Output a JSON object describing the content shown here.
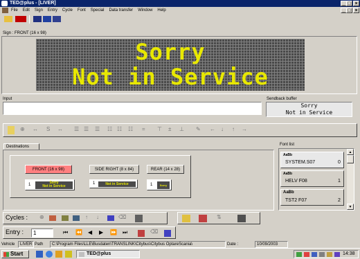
{
  "window": {
    "title": "TED@plus - [LIVER]"
  },
  "menu": [
    "File",
    "Edit",
    "Sign",
    "Entry",
    "Cycle",
    "Font",
    "Special",
    "Data transfer",
    "Window",
    "Help"
  ],
  "sign": {
    "label": "Sign : FRONT (16 x 98)",
    "line1": "Sorry",
    "line2": "Not in Service"
  },
  "input": {
    "label": "Input",
    "value": ""
  },
  "sendback": {
    "label": "Sendback buffer",
    "line1": "Sorry",
    "line2": "Not in Service"
  },
  "destinations": {
    "tab": "Destinations",
    "signs": [
      "FRONT (16 x 98)",
      "SIDE RIGHT (8 x 84)",
      "REAR (14 x 28)"
    ],
    "thumb_num": "1",
    "thumb1_l1": "Sorry",
    "thumb1_l2": "Not in Service",
    "thumb2": "Not in Service",
    "thumb3": "Sorry"
  },
  "fontlist": {
    "label": "Font list",
    "items": [
      {
        "sample": "AaBb",
        "name": "SYSTEM.S07",
        "num": "0"
      },
      {
        "sample": "AaBb",
        "name": "HELV F08",
        "num": "1"
      },
      {
        "sample": "AaBb",
        "name": "TST2 F07",
        "num": "2"
      }
    ]
  },
  "cycles": {
    "label": "Cycles :"
  },
  "entry": {
    "label": "Entry :",
    "value": "1"
  },
  "status": {
    "vehicle_label": "Vehicle",
    "vehicle": "LIVER",
    "path_label": "Path",
    "path": "C:\\Program Files\\LLE\\Busdaten\\TRANSLINK\\Citybus\\Citybus OptareScania\\",
    "date_label": "Date :",
    "date": "10/09/2003"
  },
  "taskbar": {
    "start": "Start",
    "task": "TED@plus",
    "time": "14:38"
  },
  "colors": {
    "title": "#0a246a",
    "led_on": "#e8e800",
    "led_bg": "#4a4a4a"
  }
}
